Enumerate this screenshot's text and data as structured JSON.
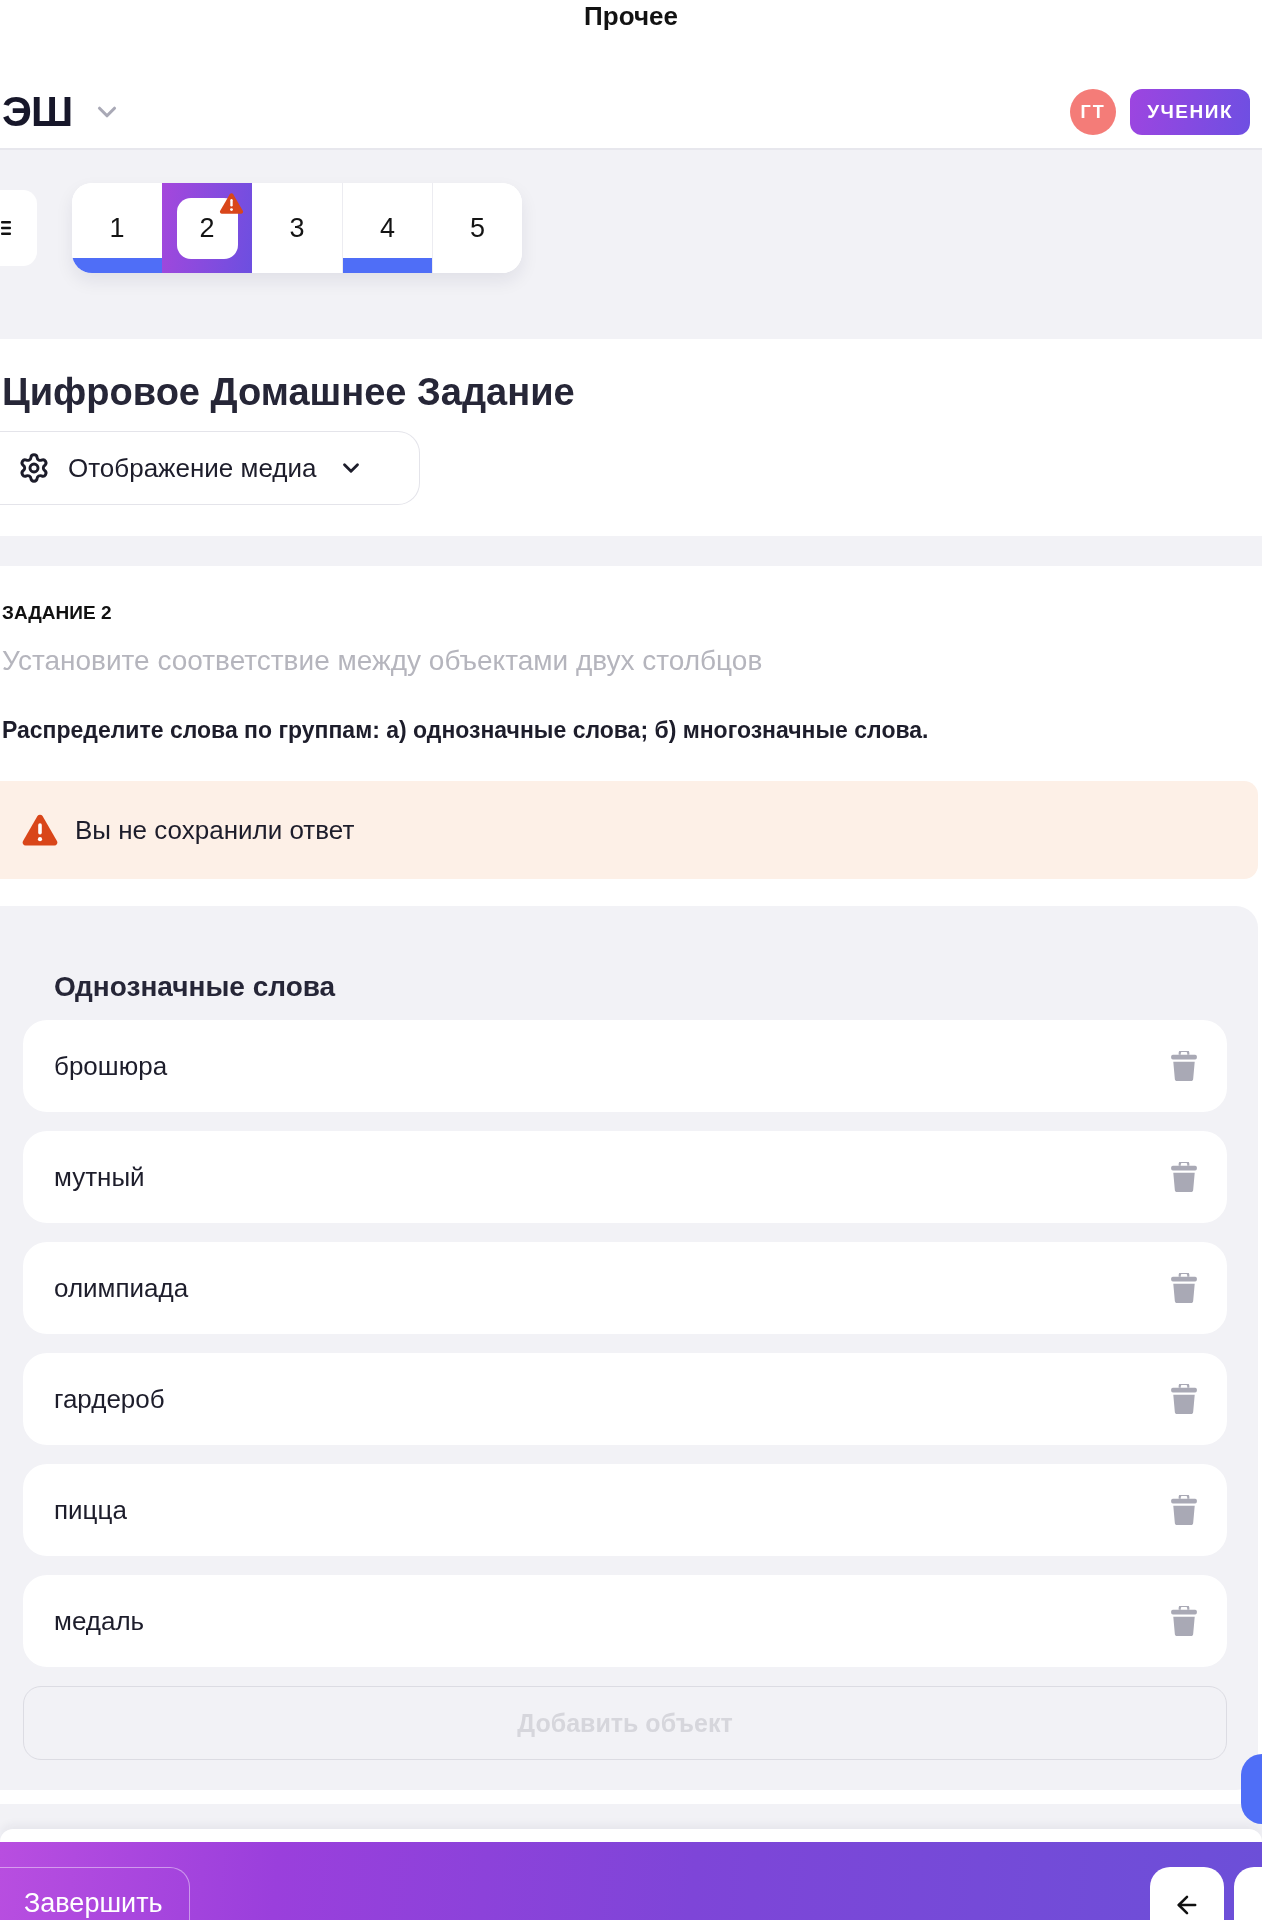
{
  "status_bar": {
    "title": "Прочее"
  },
  "header": {
    "logo": "ЭШ",
    "avatar_initials": "ГТ",
    "role_badge": "УЧЕНИК"
  },
  "task_nav": {
    "tabs": [
      {
        "label": "1",
        "selected": false,
        "answered": true,
        "warning": false
      },
      {
        "label": "2",
        "selected": true,
        "answered": false,
        "warning": true
      },
      {
        "label": "3",
        "selected": false,
        "answered": false,
        "warning": false
      },
      {
        "label": "4",
        "selected": false,
        "answered": true,
        "warning": false
      },
      {
        "label": "5",
        "selected": false,
        "answered": false,
        "warning": false
      }
    ]
  },
  "title_card": {
    "title": "Цифровое Домашнее Задание",
    "media_dropdown": {
      "label": "Отображение медиа",
      "expanded": false
    }
  },
  "task": {
    "number_label": "ЗАДАНИЕ 2",
    "type_hint": "Установите соответствие между объектами двух столбцов",
    "question": "Распределите слова по группам: а) однозначные слова; б) многозначные слова.",
    "warning": "Вы не сохранили ответ",
    "group": {
      "title": "Однозначные слова",
      "items": [
        "брошюра",
        "мутный",
        "олимпиада",
        "гардероб",
        "пицца",
        "медаль"
      ],
      "add_button": {
        "label": "Добавить объект",
        "disabled": true
      }
    }
  },
  "footer": {
    "finish_button": "Завершить"
  }
}
